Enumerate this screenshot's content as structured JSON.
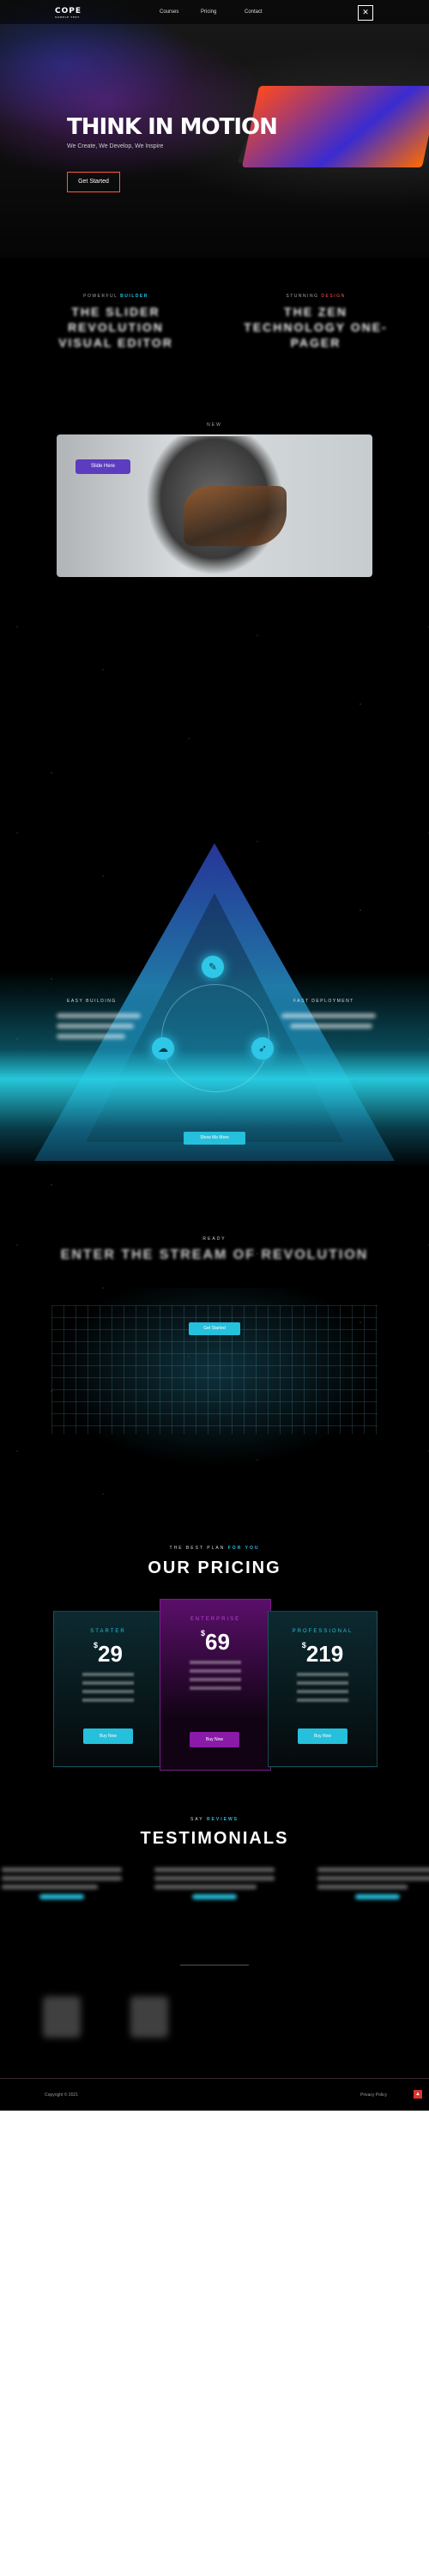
{
  "nav": {
    "logo": "COPE",
    "logo_tagline": "SAMPLE TEXT",
    "links": [
      "Courses",
      "Pricing",
      "Contact"
    ],
    "menu_icon": "hamburger-icon"
  },
  "hero": {
    "title": "THINK IN MOTION",
    "subtitle": "We Create, We Develop, We Inspire",
    "cta": "Get Started"
  },
  "products": [
    {
      "eyebrow_a": "POWERFUL",
      "eyebrow_b": "BUILDER",
      "title": "THE SLIDER REVOLUTION VISUAL EDITOR"
    },
    {
      "eyebrow_a": "STUNNING",
      "eyebrow_b": "DESIGN",
      "title": "THE ZEN TECHNOLOGY ONE-PAGER"
    }
  ],
  "video": {
    "eyebrow": "NEW",
    "button": "Slide Here"
  },
  "features": {
    "left_label": "EASY BUILDING",
    "right_label": "FAST DEPLOYMENT",
    "cta": "Show Me More",
    "node_icons": [
      "tools-icon",
      "cloud-icon",
      "rocket-icon"
    ]
  },
  "stream": {
    "eyebrow": "READY",
    "title": "ENTER THE STREAM OF REVOLUTION",
    "cta": "Get Started"
  },
  "pricing": {
    "eyebrow_a": "THE BEST PLAN",
    "eyebrow_b": "FOR YOU",
    "title": "OUR PRICING",
    "plans": [
      {
        "name": "STARTER",
        "currency": "$",
        "price": "29",
        "button": "Buy Now"
      },
      {
        "name": "ENTERPRISE",
        "currency": "$",
        "price": "69",
        "button": "Buy Now"
      },
      {
        "name": "PROFESSIONAL",
        "currency": "$",
        "price": "219",
        "button": "Buy Now"
      }
    ]
  },
  "testimonials": {
    "eyebrow_a": "SAY",
    "eyebrow_b": "REVIEWS",
    "title": "TESTIMONIALS"
  },
  "footer": {
    "copyright": "Copyright © 2021",
    "nav": "Privacy Policy",
    "top_icon": "arrow-up-icon"
  },
  "colors": {
    "accent": "#25c0dc",
    "highlight": "#ff5a3c",
    "purple": "#8a1aa8"
  }
}
